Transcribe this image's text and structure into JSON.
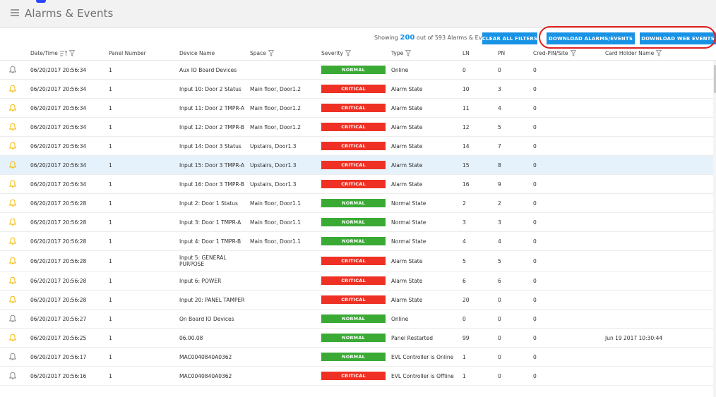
{
  "header": {
    "title": "Alarms & Events"
  },
  "toolbar": {
    "showing_prefix": "Showing ",
    "showing_count": "200",
    "showing_suffix": " out of 593 Alarms & Events",
    "clear_filters": "CLEAR ALL FILTERS",
    "download_alarms": "DOWNLOAD ALARMS/EVENTS",
    "download_web": "DOWNLOAD WEB EVENTS"
  },
  "columns": {
    "datetime": "Date/Time",
    "panel": "Panel Number",
    "device": "Device Name",
    "space": "Space",
    "severity": "Severity",
    "type": "Type",
    "ln": "LN",
    "pn": "PN",
    "cred": "Cred-PIN/Site",
    "holder": "Card Holder Name"
  },
  "colors": {
    "accent": "#1792e5",
    "normal": "#3aaa35",
    "critical": "#ee3124",
    "bell_yellow": "#f5b800",
    "bell_gray": "#8a8a8a",
    "annotation": "#e02020"
  },
  "rows": [
    {
      "bell": "gray",
      "datetime": "06/20/2017 20:56:34",
      "panel": "1",
      "device": "Aux IO Board Devices",
      "space": "",
      "severity": "NORMAL",
      "type": "Online",
      "ln": "0",
      "pn": "0",
      "cred": "0",
      "holder": ""
    },
    {
      "bell": "yellow",
      "datetime": "06/20/2017 20:56:34",
      "panel": "1",
      "device": "Input 10: Door 2 Status",
      "space": "Main floor, Door1.2",
      "severity": "CRITICAL",
      "type": "Alarm State",
      "ln": "10",
      "pn": "3",
      "cred": "0",
      "holder": ""
    },
    {
      "bell": "yellow",
      "datetime": "06/20/2017 20:56:34",
      "panel": "1",
      "device": "Input 11: Door 2 TMPR-A",
      "space": "Main floor, Door1.2",
      "severity": "CRITICAL",
      "type": "Alarm State",
      "ln": "11",
      "pn": "4",
      "cred": "0",
      "holder": ""
    },
    {
      "bell": "yellow",
      "datetime": "06/20/2017 20:56:34",
      "panel": "1",
      "device": "Input 12: Door 2 TMPR-B",
      "space": "Main floor, Door1.2",
      "severity": "CRITICAL",
      "type": "Alarm State",
      "ln": "12",
      "pn": "5",
      "cred": "0",
      "holder": ""
    },
    {
      "bell": "yellow",
      "datetime": "06/20/2017 20:56:34",
      "panel": "1",
      "device": "Input 14: Door 3 Status",
      "space": "Upstairs, Door1.3",
      "severity": "CRITICAL",
      "type": "Alarm State",
      "ln": "14",
      "pn": "7",
      "cred": "0",
      "holder": ""
    },
    {
      "bell": "yellow",
      "selected": true,
      "datetime": "06/20/2017 20:56:34",
      "panel": "1",
      "device": "Input 15: Door 3 TMPR-A",
      "space": "Upstairs, Door1.3",
      "severity": "CRITICAL",
      "type": "Alarm State",
      "ln": "15",
      "pn": "8",
      "cred": "0",
      "holder": ""
    },
    {
      "bell": "yellow",
      "datetime": "06/20/2017 20:56:34",
      "panel": "1",
      "device": "Input 16: Door 3 TMPR-B",
      "space": "Upstairs, Door1.3",
      "severity": "CRITICAL",
      "type": "Alarm State",
      "ln": "16",
      "pn": "9",
      "cred": "0",
      "holder": ""
    },
    {
      "bell": "yellow",
      "datetime": "06/20/2017 20:56:28",
      "panel": "1",
      "device": "Input 2: Door 1 Status",
      "space": "Main floor, Door1.1",
      "severity": "NORMAL",
      "type": "Normal State",
      "ln": "2",
      "pn": "2",
      "cred": "0",
      "holder": ""
    },
    {
      "bell": "yellow",
      "datetime": "06/20/2017 20:56:28",
      "panel": "1",
      "device": "Input 3: Door 1 TMPR-A",
      "space": "Main floor, Door1.1",
      "severity": "NORMAL",
      "type": "Normal State",
      "ln": "3",
      "pn": "3",
      "cred": "0",
      "holder": ""
    },
    {
      "bell": "yellow",
      "datetime": "06/20/2017 20:56:28",
      "panel": "1",
      "device": "Input 4: Door 1 TMPR-B",
      "space": "Main floor, Door1.1",
      "severity": "NORMAL",
      "type": "Normal State",
      "ln": "4",
      "pn": "4",
      "cred": "0",
      "holder": ""
    },
    {
      "bell": "yellow",
      "tall": true,
      "datetime": "06/20/2017 20:56:28",
      "panel": "1",
      "device": "Input 5: GENERAL PURPOSE",
      "space": "",
      "severity": "CRITICAL",
      "type": "Alarm State",
      "ln": "5",
      "pn": "5",
      "cred": "0",
      "holder": ""
    },
    {
      "bell": "yellow",
      "datetime": "06/20/2017 20:56:28",
      "panel": "1",
      "device": "Input 6: POWER",
      "space": "",
      "severity": "CRITICAL",
      "type": "Alarm State",
      "ln": "6",
      "pn": "6",
      "cred": "0",
      "holder": ""
    },
    {
      "bell": "yellow",
      "datetime": "06/20/2017 20:56:28",
      "panel": "1",
      "device": "Input 20: PANEL TAMPER",
      "space": "",
      "severity": "CRITICAL",
      "type": "Alarm State",
      "ln": "20",
      "pn": "0",
      "cred": "0",
      "holder": ""
    },
    {
      "bell": "gray",
      "datetime": "06/20/2017 20:56:27",
      "panel": "1",
      "device": "On Board IO Devices",
      "space": "",
      "severity": "NORMAL",
      "type": "Online",
      "ln": "0",
      "pn": "0",
      "cred": "0",
      "holder": ""
    },
    {
      "bell": "yellow",
      "datetime": "06/20/2017 20:56:25",
      "panel": "1",
      "device": "06.00.08",
      "space": "",
      "severity": "NORMAL",
      "type": "Panel Restarted",
      "ln": "99",
      "pn": "0",
      "cred": "0",
      "holder": "Jun 19 2017 10:30:44"
    },
    {
      "bell": "gray",
      "datetime": "06/20/2017 20:56:17",
      "panel": "1",
      "device": "MAC0040840A0362",
      "space": "",
      "severity": "NORMAL",
      "type": "EVL Controller is Online",
      "ln": "1",
      "pn": "0",
      "cred": "0",
      "holder": ""
    },
    {
      "bell": "gray",
      "datetime": "06/20/2017 20:56:16",
      "panel": "1",
      "device": "MAC0040840A0362",
      "space": "",
      "severity": "CRITICAL",
      "type": "EVL Controller is Offline",
      "ln": "1",
      "pn": "0",
      "cred": "0",
      "holder": ""
    }
  ]
}
